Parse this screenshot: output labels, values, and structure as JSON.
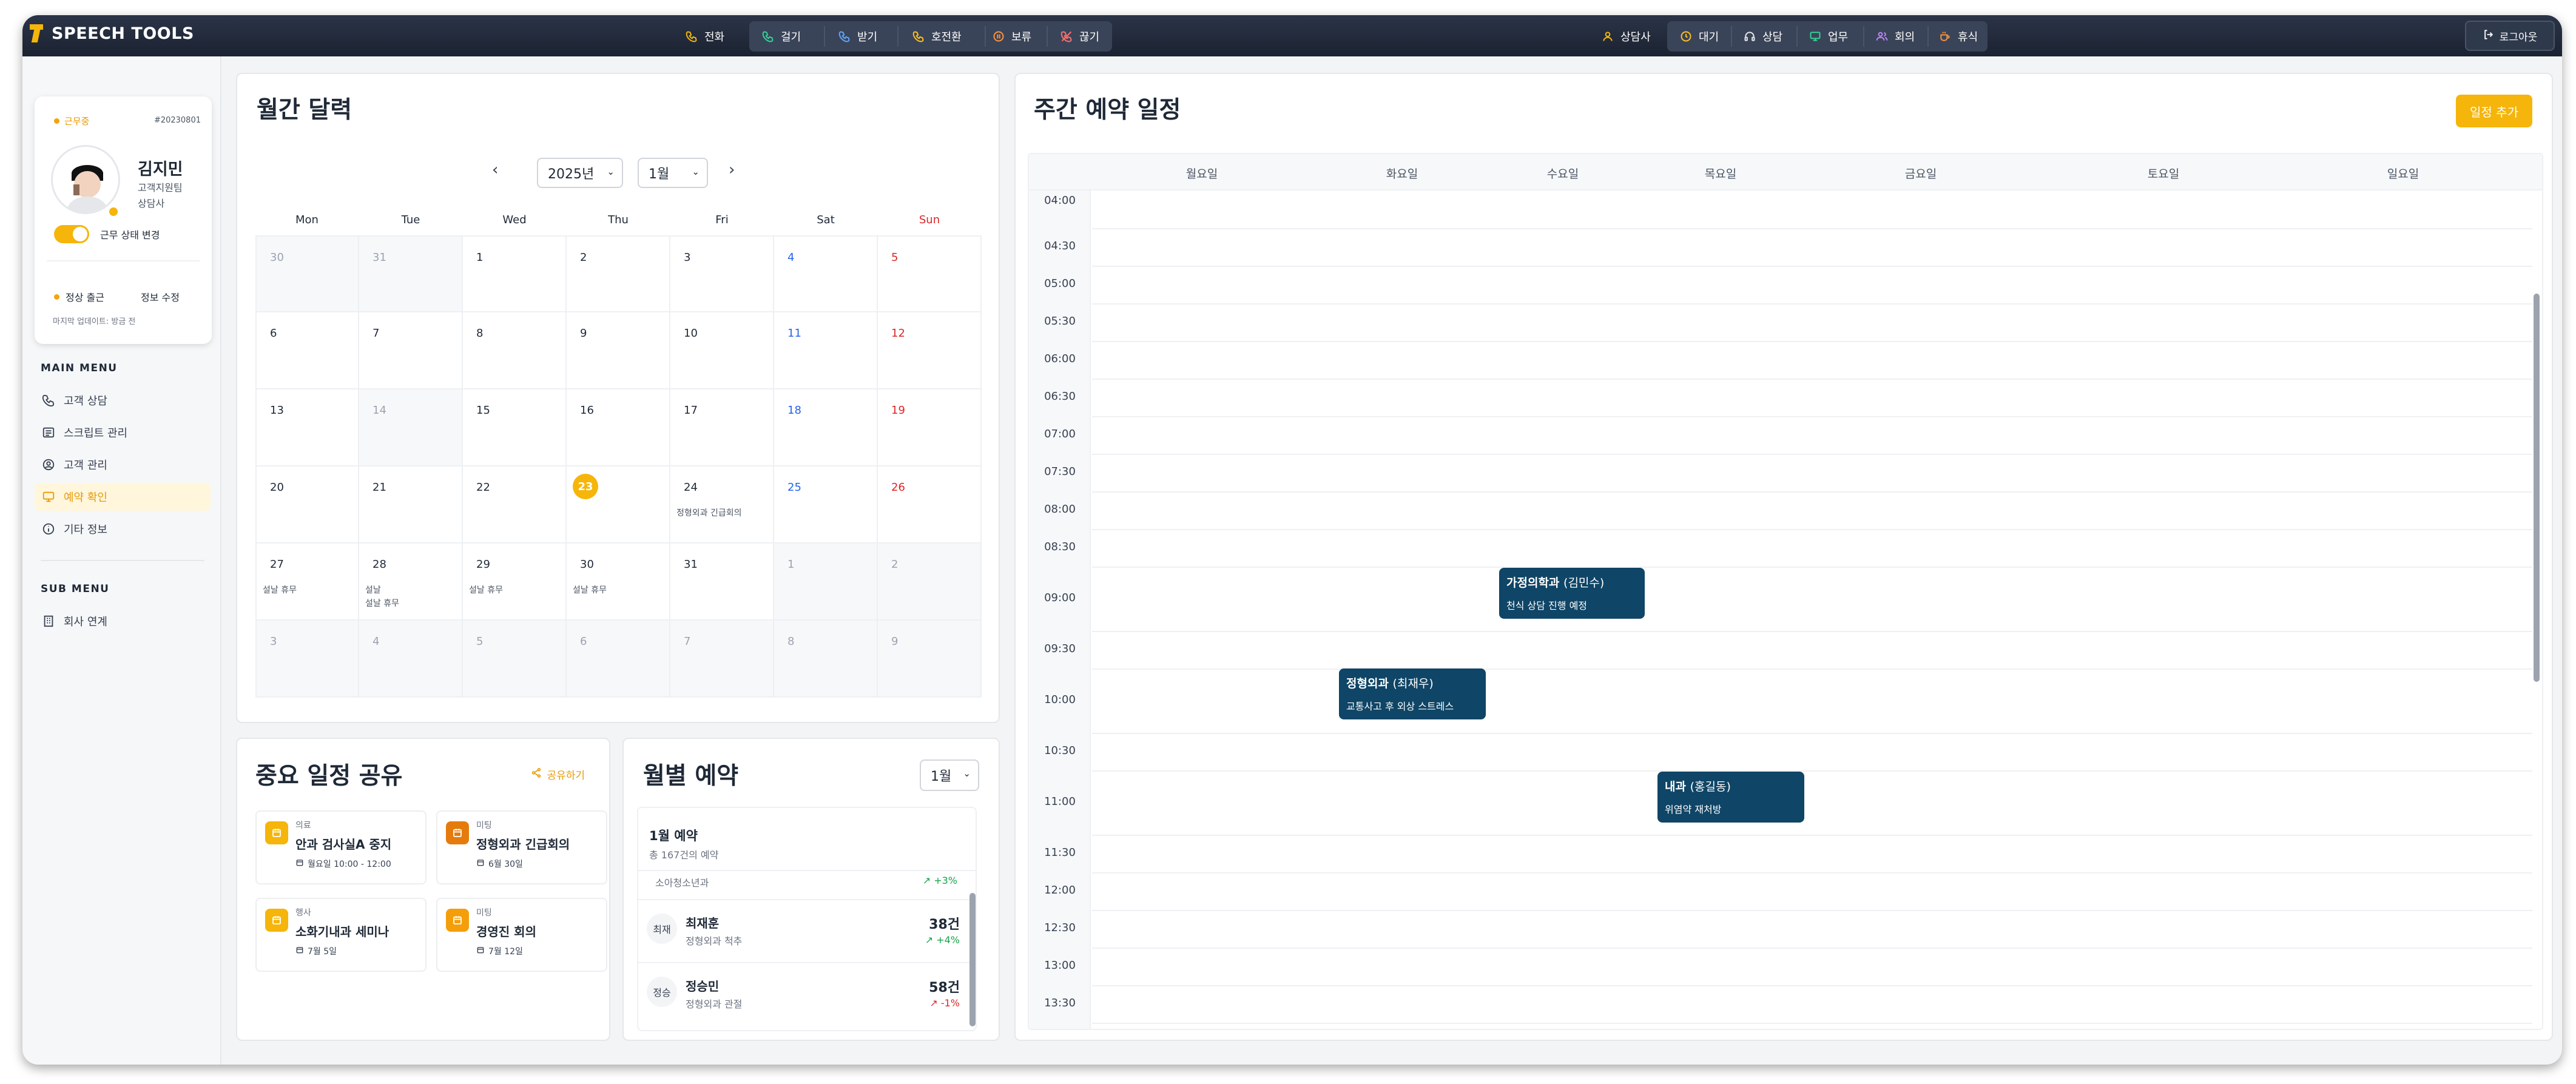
{
  "header": {
    "logo": "SPEECH TOOLS",
    "call_main": "전화",
    "call_items": [
      "걸기",
      "받기",
      "호전환",
      "보류",
      "끊기"
    ],
    "agent_main": "상담사",
    "agent_items": [
      "대기",
      "상담",
      "업무",
      "회의",
      "휴식"
    ],
    "logout": "로그아웃"
  },
  "colors": {
    "accent": "#f5b50a",
    "header": "#1f2737",
    "appointment": "#0f4566",
    "sun": "#dc2626",
    "sat": "#2563eb"
  },
  "profile": {
    "status": "근무중",
    "id": "#20230801",
    "name": "김지민",
    "dept": "고객지원팀",
    "role": "상담사",
    "toggle_label": "근무 상태 변경",
    "attend": "정상 출근",
    "edit": "정보 수정",
    "updated": "마지막 업데이트: 방금 전"
  },
  "sidebar": {
    "main_menu": "MAIN MENU",
    "items": [
      {
        "icon": "phone-icon",
        "label": "고객 상담"
      },
      {
        "icon": "script-icon",
        "label": "스크립트 관리"
      },
      {
        "icon": "user-circle-icon",
        "label": "고객 관리"
      },
      {
        "icon": "monitor-icon",
        "label": "예약 확인"
      },
      {
        "icon": "info-icon",
        "label": "기타 정보"
      }
    ],
    "sub_menu": "SUB MENU",
    "sub_items": [
      {
        "icon": "building-icon",
        "label": "회사 연계"
      }
    ]
  },
  "calendar": {
    "title": "월간 달력",
    "year": "2025년",
    "month": "1월",
    "days": [
      "Mon",
      "Tue",
      "Wed",
      "Thu",
      "Fri",
      "Sat",
      "Sun"
    ],
    "weeks": [
      [
        {
          "d": "30",
          "o": true
        },
        {
          "d": "31",
          "o": true
        },
        {
          "d": "1"
        },
        {
          "d": "2"
        },
        {
          "d": "3"
        },
        {
          "d": "4"
        },
        {
          "d": "5"
        }
      ],
      [
        {
          "d": "6"
        },
        {
          "d": "7"
        },
        {
          "d": "8"
        },
        {
          "d": "9"
        },
        {
          "d": "10"
        },
        {
          "d": "11"
        },
        {
          "d": "12"
        }
      ],
      [
        {
          "d": "13"
        },
        {
          "d": "14",
          "o": true
        },
        {
          "d": "15"
        },
        {
          "d": "16"
        },
        {
          "d": "17"
        },
        {
          "d": "18"
        },
        {
          "d": "19"
        }
      ],
      [
        {
          "d": "20"
        },
        {
          "d": "21"
        },
        {
          "d": "22"
        },
        {
          "d": "23",
          "today": true
        },
        {
          "d": "24",
          "ev": [
            "정형외과 긴급회의"
          ]
        },
        {
          "d": "25"
        },
        {
          "d": "26"
        }
      ],
      [
        {
          "d": "27",
          "ev": [
            "설날 휴무"
          ]
        },
        {
          "d": "28",
          "ev": [
            "설날",
            "설날 휴무"
          ]
        },
        {
          "d": "29",
          "ev": [
            "설날 휴무"
          ]
        },
        {
          "d": "30",
          "ev": [
            "설날 휴무"
          ]
        },
        {
          "d": "31"
        },
        {
          "d": "1",
          "o": true
        },
        {
          "d": "2",
          "o": true
        }
      ],
      [
        {
          "d": "3",
          "o": true
        },
        {
          "d": "4",
          "o": true
        },
        {
          "d": "5",
          "o": true
        },
        {
          "d": "6",
          "o": true
        },
        {
          "d": "7",
          "o": true
        },
        {
          "d": "8",
          "o": true
        },
        {
          "d": "9",
          "o": true
        }
      ]
    ]
  },
  "shared": {
    "title": "중요 일정 공유",
    "share": "공유하기",
    "items": [
      {
        "cat": "의료",
        "title": "안과 검사실A 중지",
        "date": "월요일 10:00 - 12:00",
        "color": "#f5b50a"
      },
      {
        "cat": "미팅",
        "title": "정형외과 긴급회의",
        "date": "6월 30일",
        "color": "#e57b0c"
      },
      {
        "cat": "행사",
        "title": "소화기내과 세미나",
        "date": "7월 5일",
        "color": "#f5b50a"
      },
      {
        "cat": "미팅",
        "title": "경영진 회의",
        "date": "7월 12일",
        "color": "#f59e0b"
      }
    ]
  },
  "monthly": {
    "title": "월별 예약",
    "select": "1월",
    "heading": "1월 예약",
    "total": "총 167건의 예약",
    "partial": {
      "sub": "소아청소년과",
      "pct": "+3%"
    },
    "rows": [
      {
        "av": "최재",
        "name": "최재훈",
        "sub": "정형외과 척추",
        "count": "38건",
        "pct": "+4%",
        "up": true
      },
      {
        "av": "정승",
        "name": "정승민",
        "sub": "정형외과 관절",
        "count": "58건",
        "pct": "-1%",
        "up": false
      }
    ]
  },
  "weekly": {
    "title": "주간 예약 일정",
    "add": "일정 추가",
    "days": [
      "월요일",
      "화요일",
      "수요일",
      "목요일",
      "금요일",
      "토요일",
      "일요일"
    ],
    "times": [
      "04:00",
      "04:30",
      "05:00",
      "05:30",
      "06:00",
      "06:30",
      "07:00",
      "07:30",
      "08:00",
      "08:30",
      "09:00",
      "09:30",
      "10:00",
      "10:30",
      "11:00",
      "11:30",
      "12:00",
      "12:30",
      "13:00",
      "13:30"
    ],
    "appts": [
      {
        "dept": "가정의학과",
        "who": "(김민수)",
        "note": "천식 상담 진행 예정"
      },
      {
        "dept": "정형외과",
        "who": "(최재우)",
        "note": "교통사고 후 외상 스트레스"
      },
      {
        "dept": "내과",
        "who": "(홍길동)",
        "note": "위염약 재처방"
      }
    ]
  }
}
